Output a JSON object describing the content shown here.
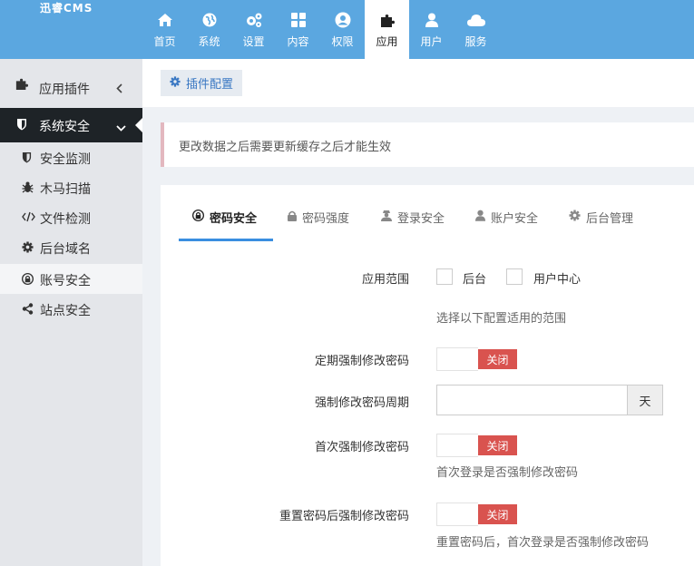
{
  "app": {
    "logo": "迅睿CMS"
  },
  "topnav": [
    {
      "label": "首页",
      "icon": "home-icon"
    },
    {
      "label": "系统",
      "icon": "globe-icon"
    },
    {
      "label": "设置",
      "icon": "cogs-icon"
    },
    {
      "label": "内容",
      "icon": "grid-icon"
    },
    {
      "label": "权限",
      "icon": "user-circle-icon"
    },
    {
      "label": "应用",
      "icon": "puzzle-icon",
      "active": true
    },
    {
      "label": "用户",
      "icon": "user-icon"
    },
    {
      "label": "服务",
      "icon": "cloud-icon"
    }
  ],
  "sidebar": {
    "plugins": {
      "label": "应用插件",
      "icon": "puzzle-icon"
    },
    "security": {
      "label": "系统安全",
      "icon": "shield-icon"
    },
    "items": [
      {
        "label": "安全监测",
        "icon": "shield-icon"
      },
      {
        "label": "木马扫描",
        "icon": "bug-icon"
      },
      {
        "label": "文件检测",
        "icon": "code-icon"
      },
      {
        "label": "后台域名",
        "icon": "gear-icon"
      },
      {
        "label": "账号安全",
        "icon": "lock-icon",
        "active": true
      },
      {
        "label": "站点安全",
        "icon": "share-icon"
      }
    ]
  },
  "breadcrumb": {
    "label": "插件配置",
    "icon": "gear-icon"
  },
  "alert": {
    "text": "更改数据之后需要更新缓存之后才能生效"
  },
  "tabs": [
    {
      "label": "密码安全",
      "icon": "lock-circle-icon",
      "active": true
    },
    {
      "label": "密码强度",
      "icon": "lock-icon"
    },
    {
      "label": "登录安全",
      "icon": "user-secret-icon"
    },
    {
      "label": "账户安全",
      "icon": "user-icon"
    },
    {
      "label": "后台管理",
      "icon": "gear-icon"
    }
  ],
  "form": {
    "scope": {
      "label": "应用范围",
      "options": [
        "后台",
        "用户中心"
      ],
      "help": "选择以下配置适用的范围"
    },
    "periodic": {
      "label": "定期强制修改密码",
      "toggle": "关闭"
    },
    "period": {
      "label": "强制修改密码周期",
      "value": "",
      "unit": "天"
    },
    "first_login": {
      "label": "首次强制修改密码",
      "toggle": "关闭",
      "help": "首次登录是否强制修改密码"
    },
    "after_reset": {
      "label": "重置密码后强制修改密码",
      "toggle": "关闭",
      "help": "重置密码后，首次登录是否强制修改密码"
    }
  },
  "colors": {
    "topbar": "#5ba7e0",
    "sidebar_dark": "#1e2327",
    "toggle_off": "#d9534f",
    "accent": "#3a8ee0"
  }
}
